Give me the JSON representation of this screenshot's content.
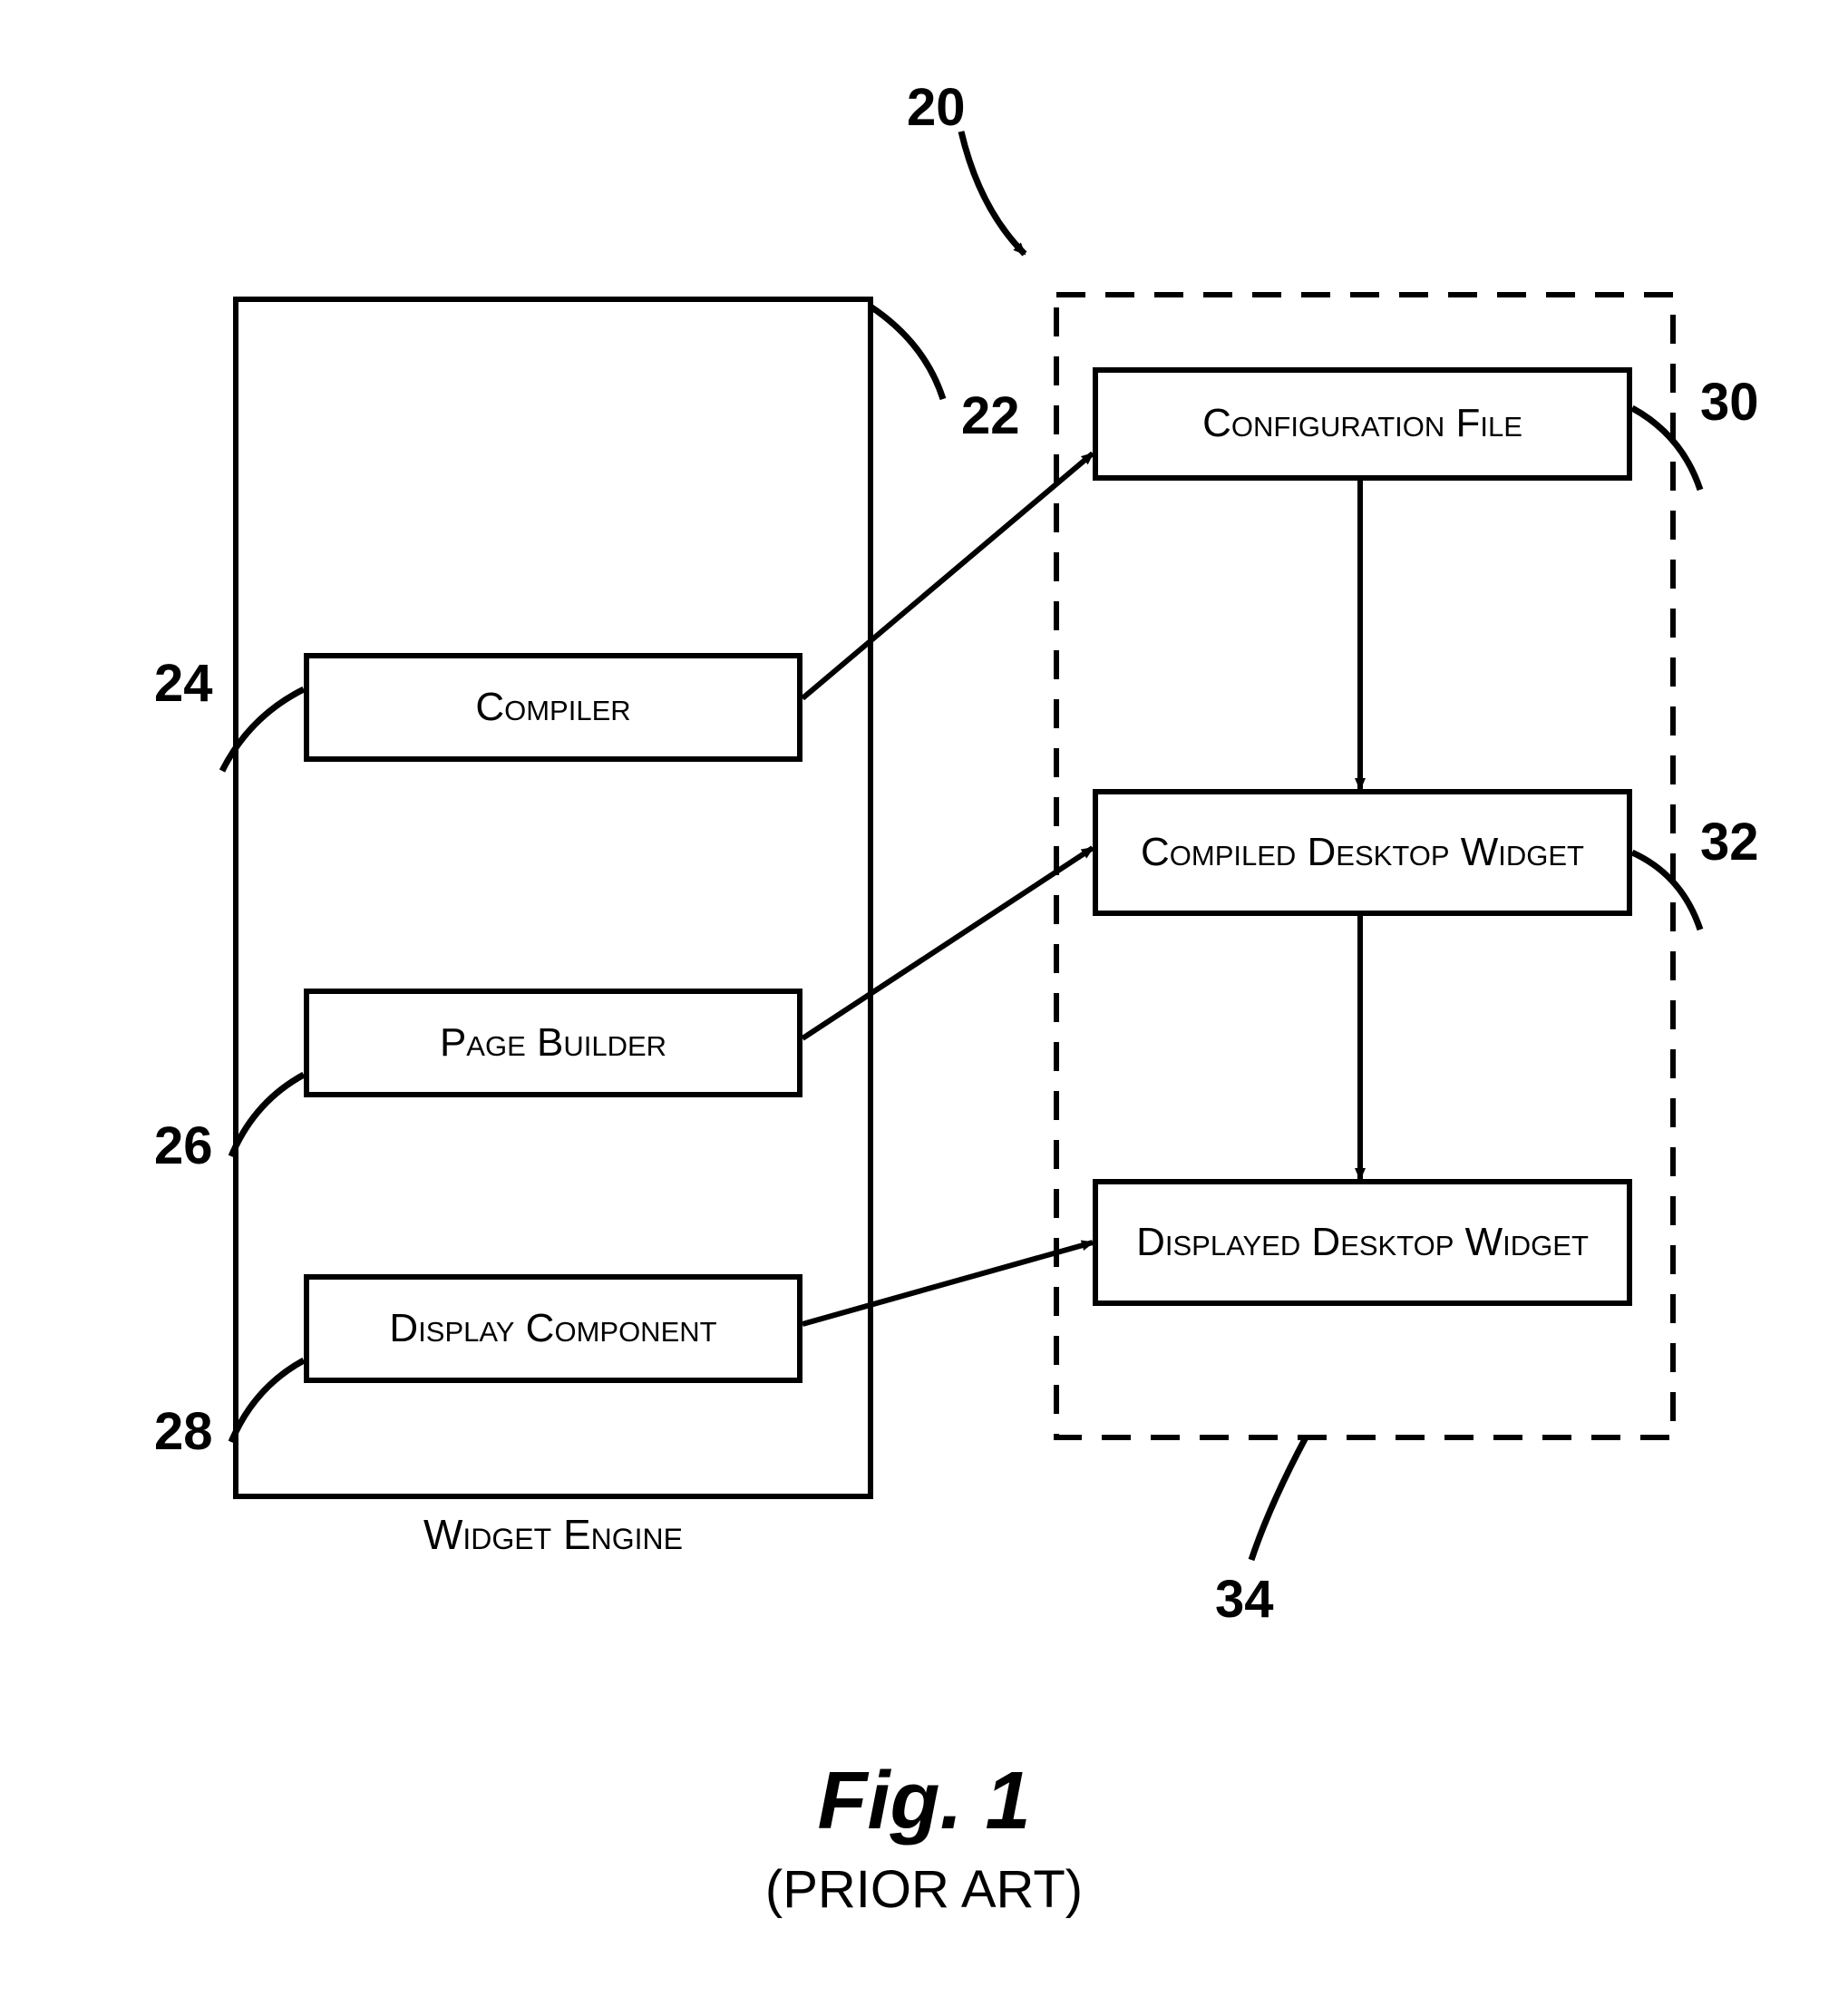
{
  "refs": {
    "top": "20",
    "engine": "22",
    "compiler": "24",
    "pageBuilder": "26",
    "display": "28",
    "config": "30",
    "compiled": "32",
    "displayed": "34"
  },
  "boxes": {
    "compiler": "Compiler",
    "pageBuilder": "Page Builder",
    "displayComponent": "Display Component",
    "configFile": "Configuration File",
    "compiledWidget": "Compiled Desktop Widget",
    "displayedWidget": "Displayed Desktop Widget",
    "engineLabel": "Widget Engine"
  },
  "figure": {
    "title": "Fig. 1",
    "subtitle": "(PRIOR ART)"
  }
}
